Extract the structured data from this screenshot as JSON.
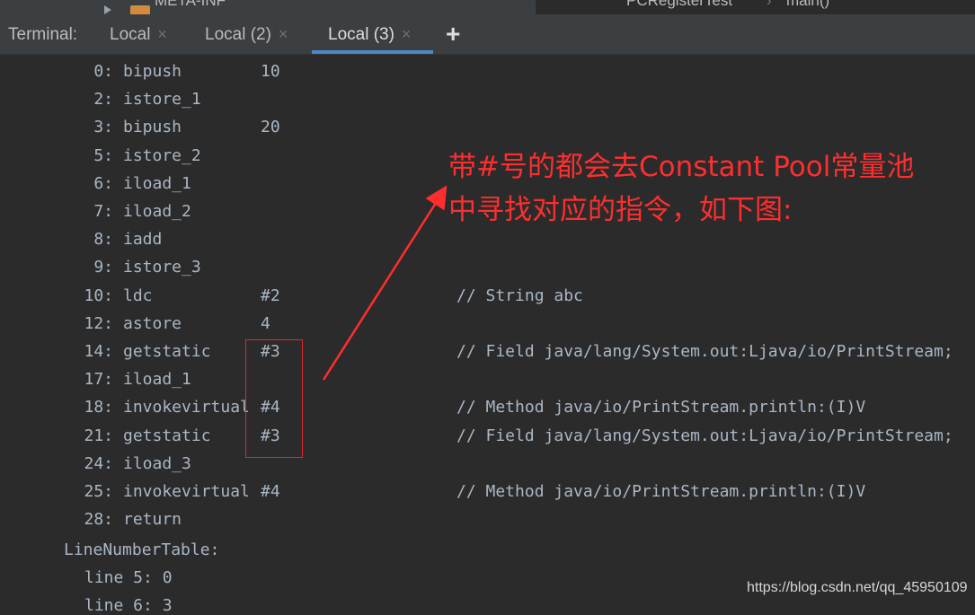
{
  "top_strip": {
    "project_item": "META-INF",
    "editor_breadcrumb": [
      "PCRegisterTest",
      "main()"
    ]
  },
  "tabbar": {
    "label": "Terminal:",
    "tabs": [
      "Local",
      "Local (2)",
      "Local (3)"
    ],
    "close_glyph": "×",
    "add_glyph": "+"
  },
  "bytecode": [
    {
      "offset": "0:",
      "op": "bipush",
      "arg": "10",
      "comment": ""
    },
    {
      "offset": "2:",
      "op": "istore_1",
      "arg": "",
      "comment": ""
    },
    {
      "offset": "3:",
      "op": "bipush",
      "arg": "20",
      "comment": ""
    },
    {
      "offset": "5:",
      "op": "istore_2",
      "arg": "",
      "comment": ""
    },
    {
      "offset": "6:",
      "op": "iload_1",
      "arg": "",
      "comment": ""
    },
    {
      "offset": "7:",
      "op": "iload_2",
      "arg": "",
      "comment": ""
    },
    {
      "offset": "8:",
      "op": "iadd",
      "arg": "",
      "comment": ""
    },
    {
      "offset": "9:",
      "op": "istore_3",
      "arg": "",
      "comment": ""
    },
    {
      "offset": "10:",
      "op": "ldc",
      "arg": "#2",
      "comment": "// String abc"
    },
    {
      "offset": "12:",
      "op": "astore",
      "arg": "4",
      "comment": ""
    },
    {
      "offset": "14:",
      "op": "getstatic",
      "arg": "#3",
      "comment": "// Field java/lang/System.out:Ljava/io/PrintStream;"
    },
    {
      "offset": "17:",
      "op": "iload_1",
      "arg": "",
      "comment": ""
    },
    {
      "offset": "18:",
      "op": "invokevirtual",
      "arg": "#4",
      "comment": "// Method java/io/PrintStream.println:(I)V"
    },
    {
      "offset": "21:",
      "op": "getstatic",
      "arg": "#3",
      "comment": "// Field java/lang/System.out:Ljava/io/PrintStream;"
    },
    {
      "offset": "24:",
      "op": "iload_3",
      "arg": "",
      "comment": ""
    },
    {
      "offset": "25:",
      "op": "invokevirtual",
      "arg": "#4",
      "comment": "// Method java/io/PrintStream.println:(I)V"
    },
    {
      "offset": "28:",
      "op": "return",
      "arg": "",
      "comment": ""
    }
  ],
  "line_number_table": {
    "header": "LineNumberTable:",
    "entries": [
      "line 5: 0",
      "line 6: 3"
    ]
  },
  "annotation": {
    "line1": "带#号的都会去Constant Pool常量池",
    "line2": "中寻找对应的指令，如下图:",
    "color": "#ff2e2e"
  },
  "watermark": "https://blog.csdn.net/qq_45950109"
}
